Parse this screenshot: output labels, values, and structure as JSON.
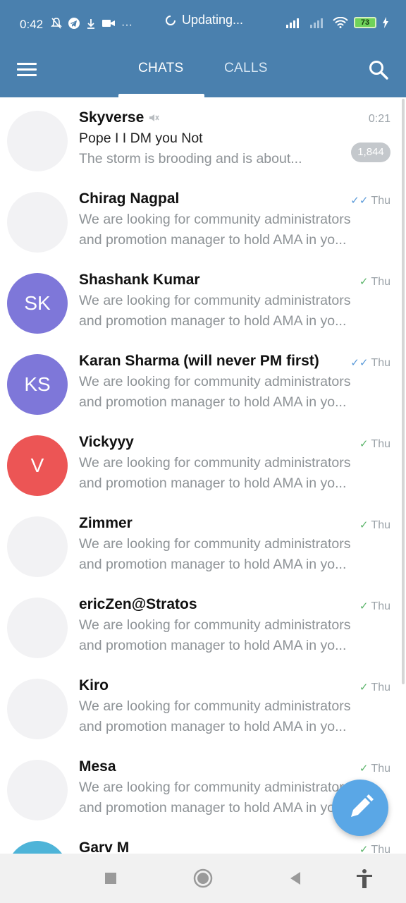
{
  "status_bar": {
    "time": "0:42",
    "updating_text": "Updating...",
    "battery": "73",
    "icons": [
      "mute-icon",
      "telegram-icon",
      "download-icon",
      "video-icon",
      "more-icon",
      "signal-icon",
      "wifi-icon",
      "battery-icon",
      "charging-icon"
    ]
  },
  "app_bar": {
    "tabs": [
      {
        "label": "CHATS",
        "active": true
      },
      {
        "label": "CALLS",
        "active": false
      }
    ]
  },
  "chats": [
    {
      "name": "Skyverse",
      "time": "0:21",
      "line1": "Pope I I DM you Not",
      "line2": "The storm is brooding and is about...",
      "muted": true,
      "unread": "1,844",
      "avatar_initials": "",
      "avatar_color": "#f2f2f4"
    },
    {
      "name": "Chirag Nagpal",
      "time": "Thu",
      "check": "double",
      "line1": "We are looking for community administrators",
      "line2": "and promotion manager to hold AMA in yo...",
      "avatar_initials": "",
      "avatar_color": "#f2f2f4"
    },
    {
      "name": "Shashank Kumar",
      "time": "Thu",
      "check": "single",
      "line1": "We are looking for community administrators",
      "line2": "and promotion manager to hold AMA in yo...",
      "avatar_initials": "SK",
      "avatar_color": "#7e77d9"
    },
    {
      "name": "Karan Sharma (will never PM first)",
      "time": "Thu",
      "check": "double",
      "line1": "We are looking for community administrators",
      "line2": "and promotion manager to hold AMA in yo...",
      "avatar_initials": "KS",
      "avatar_color": "#7e77d9"
    },
    {
      "name": "Vickyyy",
      "time": "Thu",
      "check": "single",
      "line1": "We are looking for community administrators",
      "line2": "and promotion manager to hold AMA in yo...",
      "avatar_initials": "V",
      "avatar_color": "#ec5555"
    },
    {
      "name": "Zimmer",
      "time": "Thu",
      "check": "single",
      "line1": "We are looking for community administrators",
      "line2": "and promotion manager to hold AMA in yo...",
      "avatar_initials": "",
      "avatar_color": "#f2f2f4"
    },
    {
      "name": "ericZen@Stratos",
      "time": "Thu",
      "check": "single",
      "line1": "We are looking for community administrators",
      "line2": "and promotion manager to hold AMA in yo...",
      "avatar_initials": "",
      "avatar_color": "#f2f2f4"
    },
    {
      "name": "Kiro",
      "time": "Thu",
      "check": "single",
      "line1": "We are looking for community administrators",
      "line2": "and promotion manager to hold AMA in yo...",
      "avatar_initials": "",
      "avatar_color": "#f2f2f4"
    },
    {
      "name": "Mesa",
      "time": "Thu",
      "check": "single",
      "line1": "We are looking for community administrators",
      "line2": "and promotion manager to hold AMA in yo...",
      "avatar_initials": "",
      "avatar_color": "#f2f2f4"
    },
    {
      "name": "Garv M",
      "time": "Thu",
      "check": "single",
      "line1": "",
      "line2": "",
      "avatar_initials": "",
      "avatar_color": "#4eb4d8"
    }
  ],
  "fab": {
    "icon": "pencil-icon"
  },
  "nav_bar": {
    "icons": [
      "recents-icon",
      "home-icon",
      "back-icon",
      "accessibility-icon"
    ]
  },
  "colors": {
    "header": "#4a80ae",
    "fab": "#5aa7e6",
    "muted_text": "#8d9296"
  }
}
